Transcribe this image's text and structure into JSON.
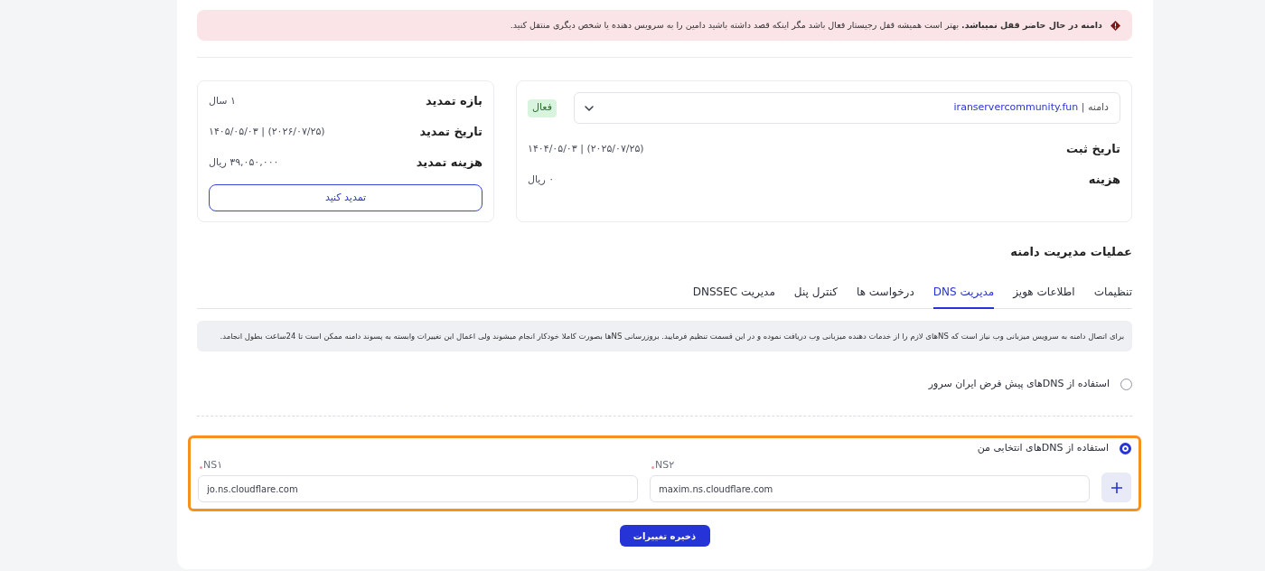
{
  "alert": {
    "text": "**دامنه در حال حاضر قفل نمیباشد.** بهتر است همیشه قفل رجیستار فعال باشد مگر اینکه قصد داشته باشید دامین را به سرویس دهنده یا شخص دیگری منتقل کنید."
  },
  "domain_card": {
    "select": {
      "prefix": "دامنه |",
      "value": "iranservercommunity.fun"
    },
    "status_badge": "فعال",
    "rows": [
      {
        "label": "تاریخ ثبت",
        "value": "۱۴۰۴/۰۵/۰۳ | (۲۰۲۵/۰۷/۲۵)"
      },
      {
        "label": "هزینه",
        "value": "۰ ریال"
      }
    ]
  },
  "renewal_card": {
    "rows": [
      {
        "label": "بازه تمدید",
        "value": "۱ سال"
      },
      {
        "label": "تاریخ تمدید",
        "value": "۱۴۰۵/۰۵/۰۳ | (۲۰۲۶/۰۷/۲۵)"
      },
      {
        "label": "هزینه تمدید",
        "value": "۳۹,۰۵۰,۰۰۰ ریال"
      }
    ],
    "button": "تمدید کنید"
  },
  "section_title": "عملیات مدیریت دامنه",
  "tabs": [
    {
      "label": "تنظیمات",
      "selected": false
    },
    {
      "label": "اطلاعات هویز",
      "selected": false
    },
    {
      "label": "مدیریت DNS",
      "selected": true
    },
    {
      "label": "درخواست ها",
      "selected": false
    },
    {
      "label": "کنترل پنل",
      "selected": false
    },
    {
      "label": "مدیریت DNSSEC",
      "selected": false
    }
  ],
  "info_text": "برای اتصال دامنه به سرویس میزبانی وب نیاز است که NSهای لازم را از خدمات دهنده میزبانی وب دریافت نموده و در این قسمت تنظیم فرمایید. بروزرسانی NSها بصورت کاملا خودکار انجام میشوند ولی اعمال این تغییرات وابسته به پسوند دامنه ممکن است تا 24ساعت بطول انجامد.",
  "dns_options": [
    {
      "kind": "default",
      "label": "استفاده از DNSهای پیش فرض ایران سرور",
      "selected": false
    },
    {
      "kind": "custom",
      "label": "استفاده از DNSهای انتخابی من",
      "selected": true,
      "fields": [
        {
          "label": "NS۲",
          "required": true,
          "value": "maxim.ns.cloudflare.com"
        },
        {
          "label": "NS۱",
          "required": true,
          "value": "jo.ns.cloudflare.com"
        }
      ]
    }
  ],
  "save_button": "ذخیره تغییرات"
}
